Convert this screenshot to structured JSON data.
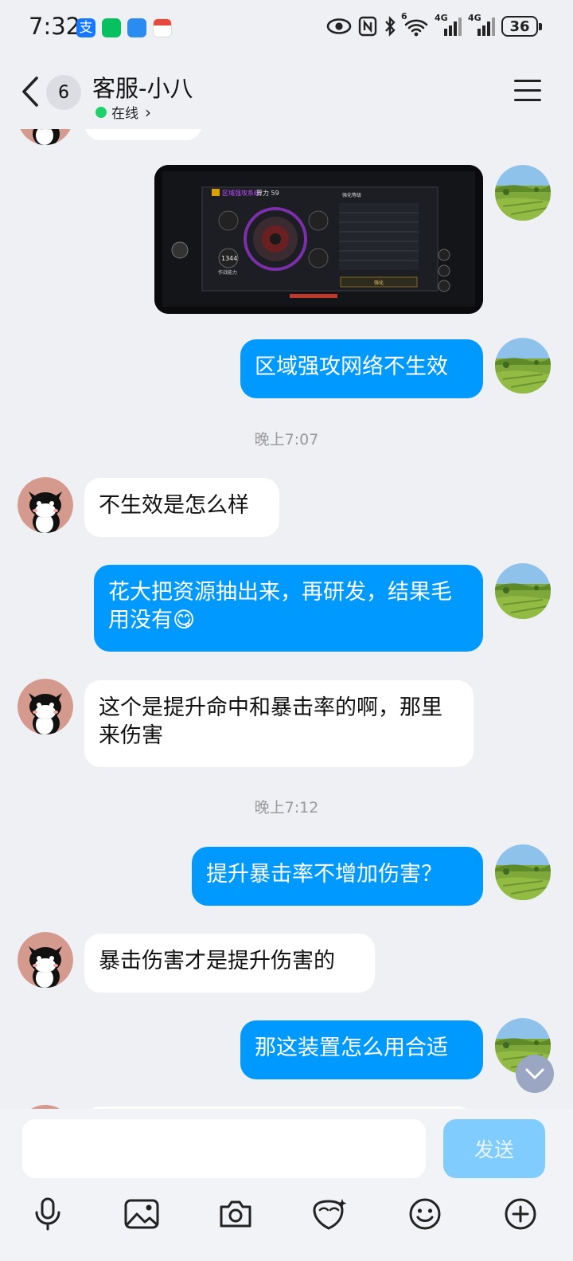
{
  "status_bar": {
    "time": "7:32",
    "network_1": "4G",
    "network_2": "4G",
    "wifi_sup": "6",
    "battery": "36"
  },
  "header": {
    "unread_count": "6",
    "title": "客服-小八",
    "status": "在线",
    "status_chevron": "›"
  },
  "messages": [
    {
      "from": "me",
      "kind": "image",
      "caption": "区域强攻系统",
      "power_label": "算力 59",
      "panel_title": "强化等级",
      "value_1344": "1344",
      "combat_label": "作战能力",
      "enhance_button": "强化"
    },
    {
      "from": "me",
      "text": "区域强攻网络不生效"
    },
    {
      "kind": "time",
      "text": "晚上7:07"
    },
    {
      "from": "agent",
      "text": "不生效是怎么样"
    },
    {
      "from": "me",
      "text": "花大把资源抽出来，再研发，结果毛用没有😋"
    },
    {
      "from": "agent",
      "text": "这个是提升命中和暴击率的啊，那里来伤害"
    },
    {
      "kind": "time",
      "text": "晚上7:12"
    },
    {
      "from": "me",
      "text": "提升暴击率不增加伤害？"
    },
    {
      "from": "agent",
      "text": "暴击伤害才是提升伤害的"
    },
    {
      "from": "me",
      "text": "那这装置怎么用合适"
    }
  ],
  "input": {
    "placeholder": "",
    "send_label": "发送"
  },
  "toolbar": [
    "microphone-icon",
    "image-icon",
    "camera-icon",
    "sticker-icon",
    "emoji-icon",
    "plus-icon"
  ],
  "colors": {
    "outgoing_bubble": "#0099ff",
    "incoming_bubble": "#ffffff",
    "background": "#eff0f4",
    "send_disabled": "#80ccff",
    "online": "#1fd36a"
  }
}
